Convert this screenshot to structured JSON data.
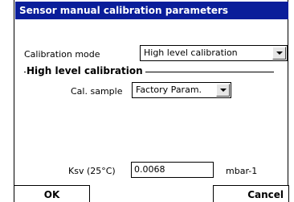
{
  "window": {
    "title": "Sensor manual calibration parameters"
  },
  "calibration_mode": {
    "label": "Calibration mode",
    "value": "High level calibration"
  },
  "group": {
    "title": "High level calibration"
  },
  "cal_sample": {
    "label": "Cal. sample",
    "value": "Factory Param."
  },
  "ksv": {
    "label": "Ksv (25°C)",
    "value": "0.0068",
    "unit": "mbar-1"
  },
  "buttons": {
    "ok": "OK",
    "cancel": "Cancel"
  },
  "icons": {
    "dropdown": "chevron-down-icon"
  }
}
